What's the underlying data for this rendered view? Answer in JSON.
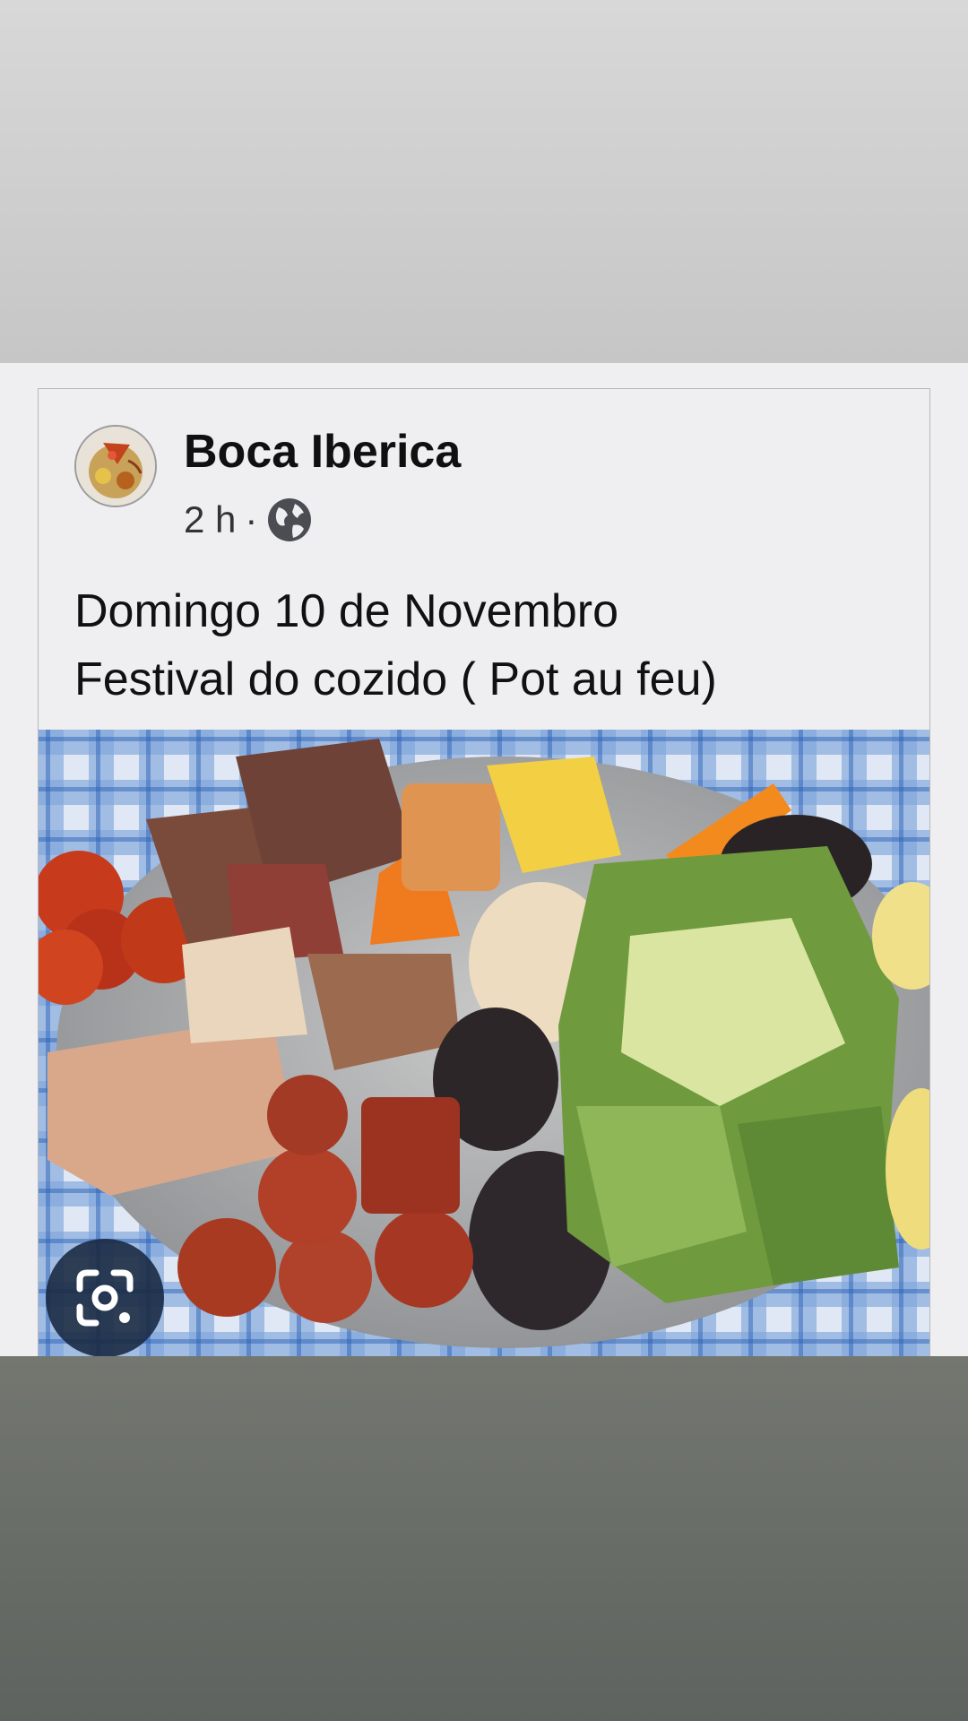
{
  "post": {
    "author": "Boca Iberica",
    "time": "2 h",
    "separator": "·",
    "visibility_icon": "globe-icon",
    "text_lines": [
      "Domingo 10 de Novembro",
      "Festival do cozido ( Pot au feu)"
    ]
  },
  "image": {
    "subject": "cozido-plate",
    "overlay_icon": "lens-search-icon"
  }
}
